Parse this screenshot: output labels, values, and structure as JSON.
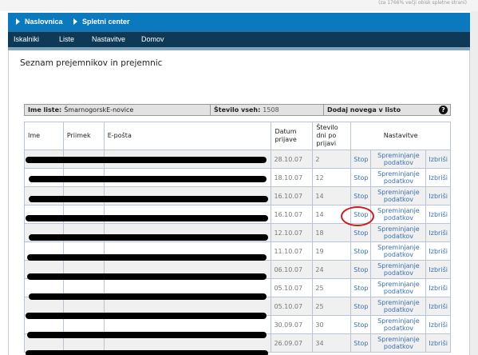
{
  "top_note": "(za 1766% večji obisk spletne strani)",
  "header": {
    "items": [
      "Naslovnica",
      "Spletni center"
    ]
  },
  "nav": {
    "items": [
      "Iskalniki",
      "Liste",
      "Nastavitve",
      "Domov"
    ]
  },
  "page_title": "Seznam prejemnikov in prejemnic",
  "info": {
    "list_name_label": "Ime liste:",
    "list_name_value": "ŠmarnogorskE-novice",
    "count_label": "Število vseh:",
    "count_value": "1508",
    "add_label": "Dodaj novega v listo",
    "help": "?"
  },
  "table": {
    "headers": {
      "name": "Ime",
      "surname": "Priimek",
      "email": "E-pošta",
      "date": "Datum prijave",
      "days": "Število dni po prijavi",
      "settings": "Nastavitve"
    },
    "action_stop": "Stop",
    "action_edit": "Spreminjanje podatkov",
    "action_delete": "Izbriši",
    "rows": [
      {
        "date": "28.10.07",
        "days": "2"
      },
      {
        "date": "18.10.07",
        "days": "12"
      },
      {
        "date": "16.10.07",
        "days": "14"
      },
      {
        "date": "16.10.07",
        "days": "14"
      },
      {
        "date": "12.10.07",
        "days": "18"
      },
      {
        "date": "11.10.07",
        "days": "19"
      },
      {
        "date": "06.10.07",
        "days": "24"
      },
      {
        "date": "05.10.07",
        "days": "25"
      },
      {
        "date": "05.10.07",
        "days": "25"
      },
      {
        "date": "30.09.07",
        "days": "30"
      },
      {
        "date": "26.09.07",
        "days": "34"
      }
    ]
  },
  "colors": {
    "header_blue": "#0a79bd",
    "nav_dark": "#0f3a57",
    "highlight": "#cc1b1b"
  }
}
